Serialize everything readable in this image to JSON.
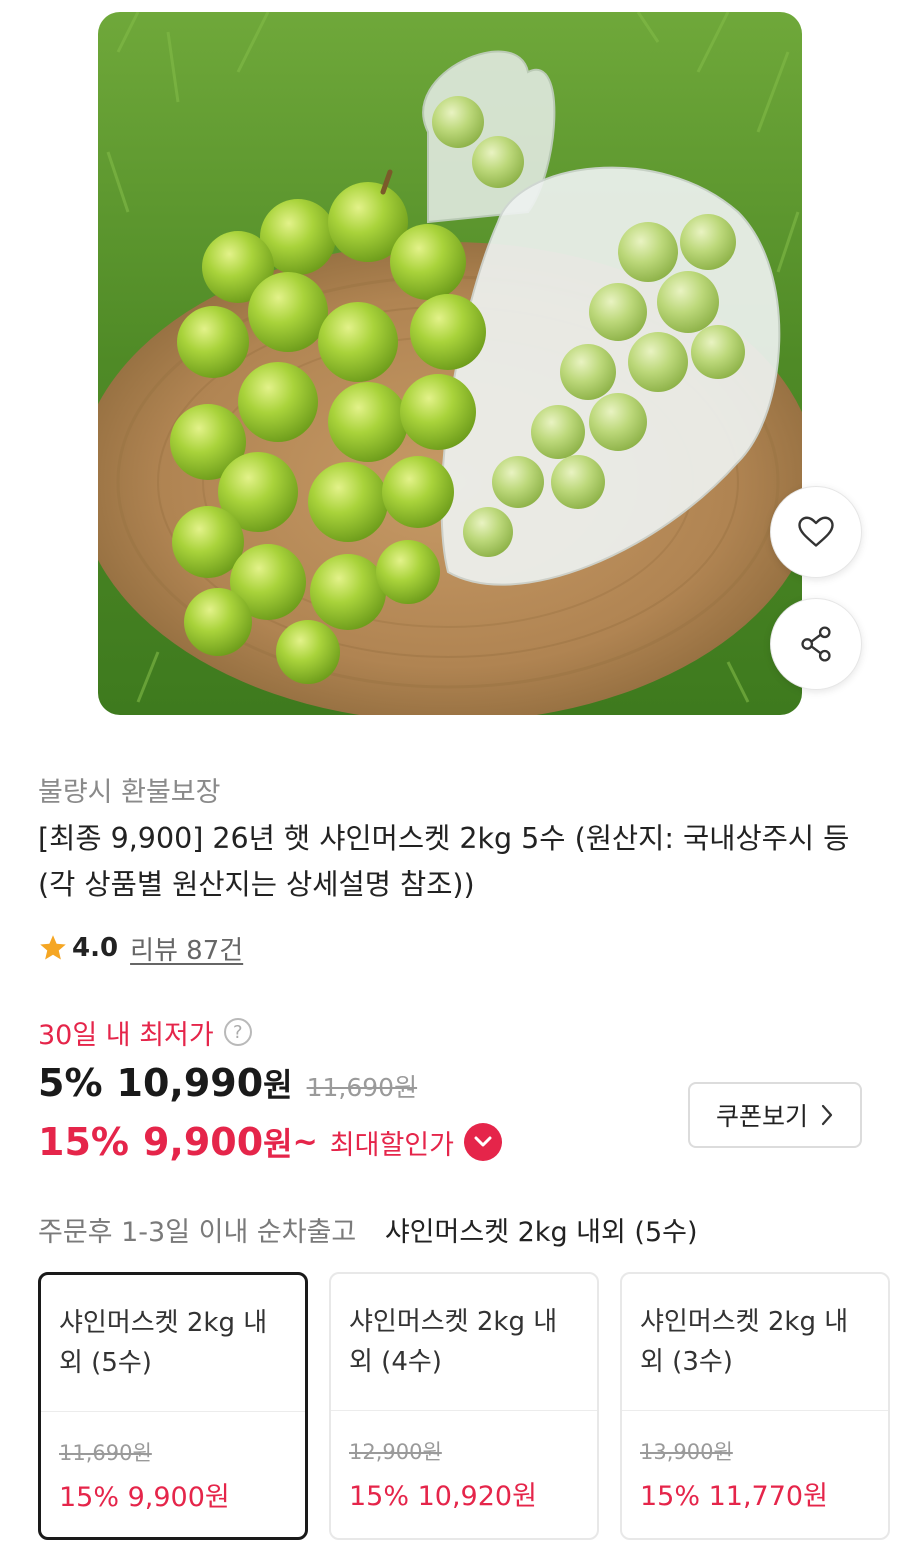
{
  "product": {
    "guarantee": "불량시 환불보장",
    "title": "[최종 9,900] 26년 햇 샤인머스켓 2kg 5수  (원산지: 국내상주시 등 (각 상품별 원산지는 상세설명 참조))"
  },
  "actions": {
    "like_icon": "heart-icon",
    "share_icon": "share-icon"
  },
  "rating": {
    "score": "4.0",
    "review_text": "리뷰 87건"
  },
  "pricing": {
    "lowest_label": "30일 내 최저가",
    "help_glyph": "?",
    "discount_rate": "5%",
    "sale_price": "10,990",
    "currency": "원",
    "original_price": "11,690원",
    "max_discount_rate": "15%",
    "max_price": "9,900",
    "tilde": "~",
    "max_label": "최대할인가",
    "coupon_button": "쿠폰보기"
  },
  "shipping": {
    "text": "주문후 1-3일 이내 순차출고",
    "selected_option": "샤인머스켓 2kg 내외 (5수)"
  },
  "options": [
    {
      "name": "샤인머스켓 2kg 내외 (5수)",
      "original": "11,690원",
      "sale": "15% 9,900원",
      "selected": true
    },
    {
      "name": "샤인머스켓 2kg 내외 (4수)",
      "original": "12,900원",
      "sale": "15% 10,920원",
      "selected": false
    },
    {
      "name": "샤인머스켓 2kg 내외 (3수)",
      "original": "13,900원",
      "sale": "15% 11,770원",
      "selected": false
    }
  ],
  "colors": {
    "accent": "#e5254a",
    "star": "#f5a623",
    "text": "#222222",
    "muted": "#8a8a8a"
  }
}
